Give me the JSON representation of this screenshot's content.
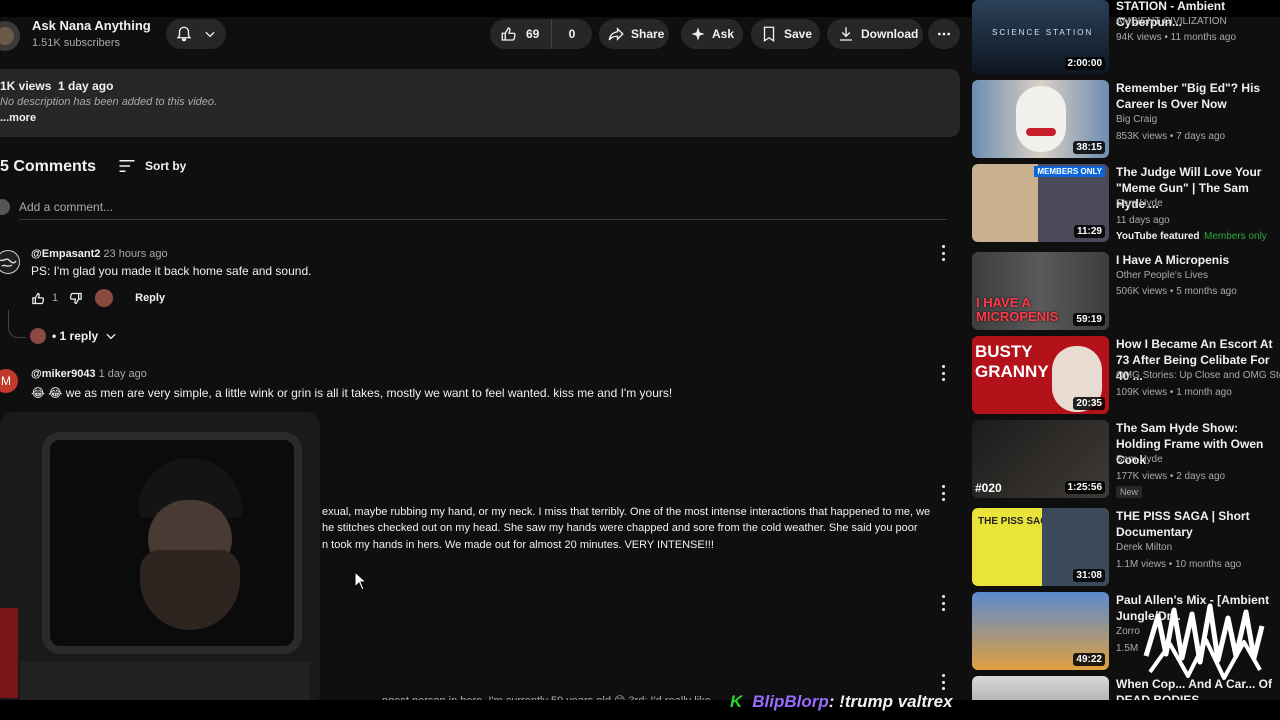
{
  "channel": {
    "name": "Ask Nana Anything",
    "subs": "1.51K subscribers"
  },
  "actions": {
    "likes": "69",
    "dislikes": "0",
    "share": "Share",
    "ask": "Ask",
    "save": "Save",
    "download": "Download"
  },
  "description": {
    "views": "1K views",
    "age": "1 day ago",
    "text": "No description has been added to this video.",
    "more": "...more"
  },
  "comments": {
    "count": "5 Comments",
    "sort": "Sort by",
    "placeholder": "Add a comment...",
    "items": [
      {
        "author": "@Empasant2",
        "time": "23 hours ago",
        "text": "PS:  I'm glad you made it back home safe and sound.",
        "likes": "1",
        "reply": "Reply",
        "replies": "• 1 reply"
      },
      {
        "author": "@miker9043",
        "time": "1 day ago",
        "text": "😂 😂  we as men are very simple, a little wink or grin is all it takes, mostly we want to feel wanted. kiss me and I'm yours!",
        "avatar_letter": "M"
      }
    ],
    "partial_lines": [
      "exual, maybe rubbing my hand, or my neck.  I miss that terribly.  One of the most intense interactions that happened to me, we",
      "he stitches checked out on my head.  She saw my hands were chapped and sore from the cold weather.  She said you poor",
      "n took my hands in hers.  We made out for almost 20 minutes.  VERY INTENSE!!!"
    ],
    "bottom_partial": "ngest person in here. I'm currently 59 years old 😊  3rd: I'd really like"
  },
  "chat": {
    "user": "BlipBlorp",
    "message": ": !trump valtrex"
  },
  "sidebar": [
    {
      "title": "STATION - Ambient Cyberpun...",
      "channel": "AMBIENT CIVILIZATION",
      "meta": "94K views • 11 months ago",
      "duration": "2:00:00",
      "thumb_color": "#1b2a3a",
      "thumb_text": "SCIENCE STATION"
    },
    {
      "title": "Remember \"Big Ed\"? His Career Is Over Now",
      "channel": "Big Craig",
      "meta": "853K views • 7 days ago",
      "duration": "38:15",
      "thumb_color": "#5a7a98",
      "thumb_text": ""
    },
    {
      "title": "The Judge Will Love Your \"Meme Gun\" | The Sam Hyde ...",
      "channel": "Sam Hyde",
      "meta": "11 days ago",
      "duration": "11:29",
      "thumb_color": "#3a3650",
      "thumb_text": "MEMBERS ONLY",
      "yt_featured": "YouTube featured",
      "members": "Members only"
    },
    {
      "title": "I Have A Micropenis",
      "channel": "Other People's Lives",
      "meta": "506K views • 5 months ago",
      "duration": "59:19",
      "thumb_color": "#3b3b3b",
      "thumb_text": "I HAVE A MICROPENIS"
    },
    {
      "title": "How I Became An Escort At 73 After Being Celibate For 40 ...",
      "channel": "OMG Stories: Up Close and OMG Stori",
      "meta": "109K views • 1 month ago",
      "duration": "20:35",
      "thumb_color": "#b3121a",
      "thumb_text": "BUSTY GRANNY"
    },
    {
      "title": "The Sam Hyde Show: Holding Frame with Owen Cook",
      "channel": "Sam Hyde",
      "meta": "177K views • 2 days ago",
      "duration": "1:25:56",
      "thumb_color": "#2a2a2a",
      "thumb_text": "#020",
      "badge": "New"
    },
    {
      "title": "THE PISS SAGA | Short Documentary",
      "channel": "Derek Milton",
      "meta": "1.1M views • 10 months ago",
      "duration": "31:08",
      "thumb_color": "#e9e33a",
      "thumb_text": "THE PISS SAGA"
    },
    {
      "title": "Paul Allen's Mix - [Ambient Jungle/Dr...",
      "channel": "Zorro",
      "meta": "1.5M",
      "duration": "49:22",
      "thumb_color": "#d07a2a",
      "thumb_text": ""
    },
    {
      "title": "When Cop... And A Car... Of DEAD BODIES",
      "channel": "",
      "meta": "",
      "duration": "",
      "thumb_color": "#888",
      "thumb_text": ""
    }
  ]
}
